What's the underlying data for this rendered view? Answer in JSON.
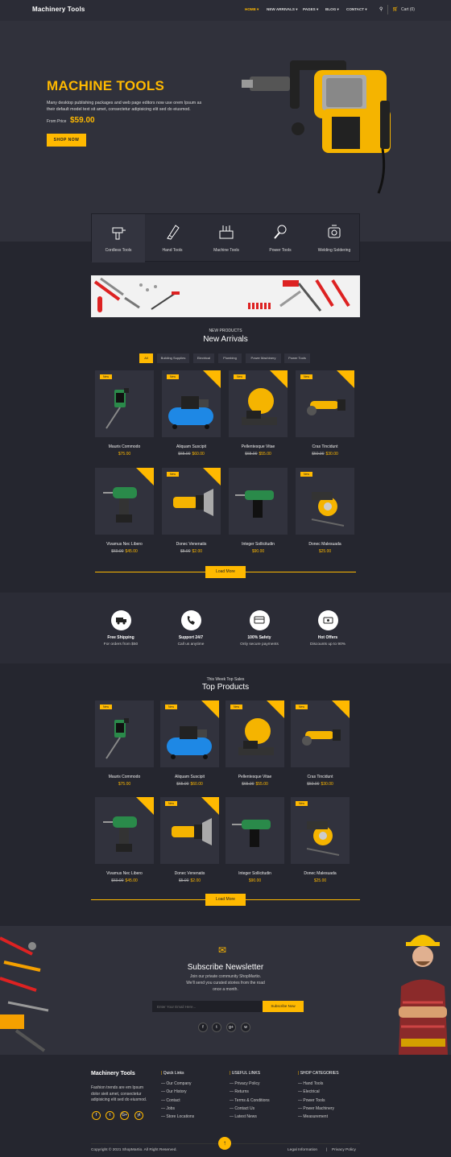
{
  "header": {
    "logo": "Machinery Tools",
    "nav": [
      "HOME",
      "NEW ARRIVALS",
      "PAGES",
      "BLOG",
      "CONTACT"
    ],
    "cart": "Cart (0)"
  },
  "hero": {
    "title": "MACHINE TOOLS",
    "description": "Many desktop publishing packages and web page editors now use orem Ipsum as their default model text sit amet, consectetur adipisicing elit sed do eiusmod.",
    "price_label": "From Price",
    "price": "$59.00",
    "button": "SHOP NOW"
  },
  "categories": [
    "Cordless Tools",
    "Hand Tools",
    "Machine Tools",
    "Power Tools",
    "Welding Soldering"
  ],
  "new_arrivals": {
    "kicker": "NEW PRODUCTS",
    "title": "New Arrivals",
    "tabs": [
      "All",
      "Building Supplies",
      "Electrical",
      "Plumbing",
      "Power Machinery",
      "Power Tools"
    ],
    "load_more": "Load More"
  },
  "products": [
    {
      "name": "Mauris Commodo",
      "old": "",
      "price": "$75.00",
      "badge": "New",
      "corner": false,
      "img": "jackhammer"
    },
    {
      "name": "Aliquam Suscipit",
      "old": "$65.00",
      "price": "$60.00",
      "badge": "New",
      "corner": true,
      "img": "compressor"
    },
    {
      "name": "Pellentesque Vitae",
      "old": "$65.00",
      "price": "$55.00",
      "badge": "New",
      "corner": true,
      "img": "chopsaw"
    },
    {
      "name": "Cras Tincidunt",
      "old": "$50.00",
      "price": "$30.00",
      "badge": "New",
      "corner": true,
      "img": "grinder"
    },
    {
      "name": "Vivamus Nec Libero",
      "old": "$60.00",
      "price": "$45.00",
      "badge": "",
      "corner": true,
      "img": "drill"
    },
    {
      "name": "Donec Venenatis",
      "old": "$5.00",
      "price": "$2.00",
      "badge": "New",
      "corner": true,
      "img": "sander"
    },
    {
      "name": "Integer Sollicitudin",
      "old": "",
      "price": "$90.00",
      "badge": "",
      "corner": false,
      "img": "hammerdrill"
    },
    {
      "name": "Donec Malesuada",
      "old": "",
      "price": "$25.00",
      "badge": "New",
      "corner": false,
      "img": "tilecutter"
    }
  ],
  "features": [
    {
      "title": "Free Shipping",
      "sub": "For orders from $50"
    },
    {
      "title": "Support 24/7",
      "sub": "Call us anytime"
    },
    {
      "title": "100% Safety",
      "sub": "Only secure payments"
    },
    {
      "title": "Hot Offers",
      "sub": "Discounts up to 90%"
    }
  ],
  "top_products": {
    "kicker": "This Week Top Sales",
    "title": "Top Products",
    "load_more": "Load More"
  },
  "newsletter": {
    "title": "Subscribe Newsletter",
    "text": "Join our private community ShopMartio. We'll send you curated stories from the road once a month.",
    "placeholder": "Enter Your Email Here...",
    "button": "Subscribe Now",
    "social": [
      "f",
      "t",
      "g+",
      "w"
    ]
  },
  "footer": {
    "logo": "Machinery Tools",
    "about": "Fashion trends are em Ipsum dolor sieit amet, consectetur adipisicing elit sed do eiusmod.",
    "social": [
      "f",
      "t",
      "G+",
      "yt"
    ],
    "quick_title": "Quick Links",
    "quick": [
      "Our Company",
      "Our History",
      "Contact",
      "Jobs",
      "Store Locations"
    ],
    "useful_title": "USEFUL LINKS",
    "useful": [
      "Privacy Policy",
      "Returns",
      "Terms & Conditions",
      "Contact Us",
      "Latest News"
    ],
    "shop_title": "SHOP CATEGORIES",
    "shop": [
      "Hand Tools",
      "Electrical",
      "Power Tools",
      "Power Machinery",
      "Measurement"
    ],
    "copyright": "Copyright © 2021 ShopMartio. All Right Reserved.",
    "legal": "Legal Information",
    "privacy": "Privacy Policy"
  },
  "colors": {
    "accent": "#ffb900",
    "bg": "#25262f",
    "card": "#31323d"
  }
}
